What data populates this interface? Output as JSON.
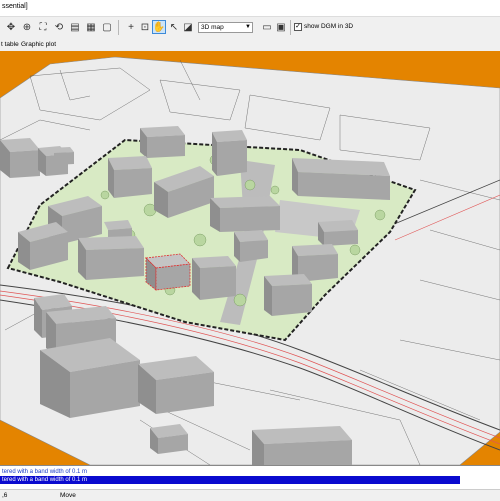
{
  "window": {
    "title": "ssential]"
  },
  "toolbar": {
    "view_select": "3D map",
    "show_dgm_label": "show DGM in 3D",
    "show_dgm_checked": true
  },
  "tabs": [
    {
      "label": "t table"
    },
    {
      "label": "Graphic plot"
    }
  ],
  "log": {
    "lines": [
      "tered with a band width of 0.1 m",
      "tered with a band width of 0.1 m"
    ]
  },
  "status": {
    "left": ",6",
    "mode": "Move"
  },
  "colors": {
    "background": "#e48400",
    "terrain": "#eeeeee",
    "site_fill": "#d8eac4",
    "building": "#a5a5a5",
    "selection": "#0a0acf",
    "road_line": "#e05555"
  }
}
